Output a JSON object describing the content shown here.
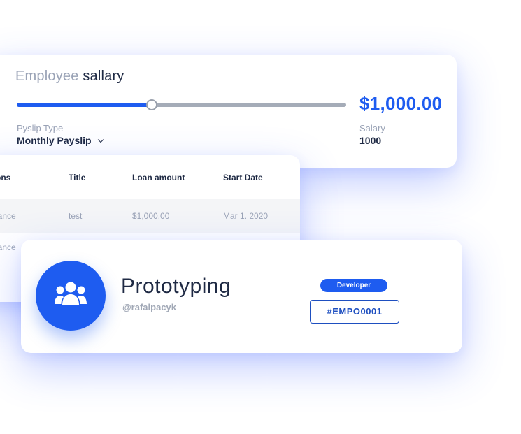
{
  "salary_card": {
    "title_light": "Employee",
    "title_dark": "sallary",
    "slider_level": 0.41,
    "amount": "$1,000.00",
    "payslip_type_label": "Pyslip Type",
    "payslip_type_value": "Monthly Payslip",
    "salary_label": "Salary",
    "salary_value": "1000"
  },
  "loans_table": {
    "columns": [
      "Options",
      "Title",
      "Loan amount",
      "Start Date"
    ],
    "rows": [
      [
        "Insurance",
        "test",
        "$1,000.00",
        "Mar 1. 2020"
      ],
      [
        "Insurance",
        "",
        "",
        ""
      ]
    ]
  },
  "profile_card": {
    "name": "Prototyping",
    "handle": "@rafalpacyk",
    "role_badge": "Developer",
    "employee_id": "#EMPO0001",
    "avatar_icon": "users-group-icon"
  },
  "colors": {
    "accent": "#1e5cf0",
    "text_dark": "#1f2a44",
    "text_muted": "#9aa3b6"
  }
}
